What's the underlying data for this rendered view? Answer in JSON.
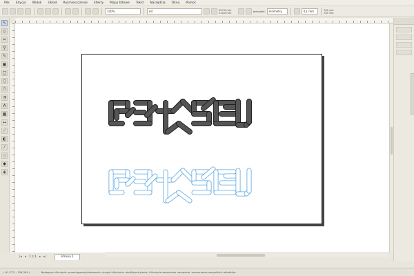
{
  "menubar": {
    "items": [
      "Plik",
      "Edycja",
      "Widok",
      "Układ",
      "Rozmieszczenie",
      "Efekty",
      "Mapy bitowe",
      "Tekst",
      "Narzędzia",
      "Okno",
      "Pomoc"
    ]
  },
  "toolbar": {
    "zoom_value": "100%",
    "page_size_value": "A4",
    "width_label": "297,0 mm",
    "height_label": "210,0 mm",
    "units_label": "Jednostki:",
    "units_value": "milimetry",
    "nudge_value": "0,1 mm",
    "dup_x_label": "5,0 mm",
    "dup_y_label": "5,0 mm"
  },
  "pagebar": {
    "first": "|◂",
    "prev": "◂",
    "count": "1 z 1",
    "next": "▸",
    "last": "▸|",
    "tab_label": "Strona 1"
  },
  "statusbar": {
    "coords": "( -41,775 ; 136,309 )",
    "hint": "Następne kliknięcie: przeciąganie/skalowanie; drugie kliknięcie: obrót/pochylenie; kliknięcie dwukrotne narzędzia: zaznaczenie wszystkich obiektów..."
  },
  "colors": {
    "logo_fill": "#555555",
    "logo_stroke": "#222222",
    "outline_blue": "#5aa7e0"
  }
}
